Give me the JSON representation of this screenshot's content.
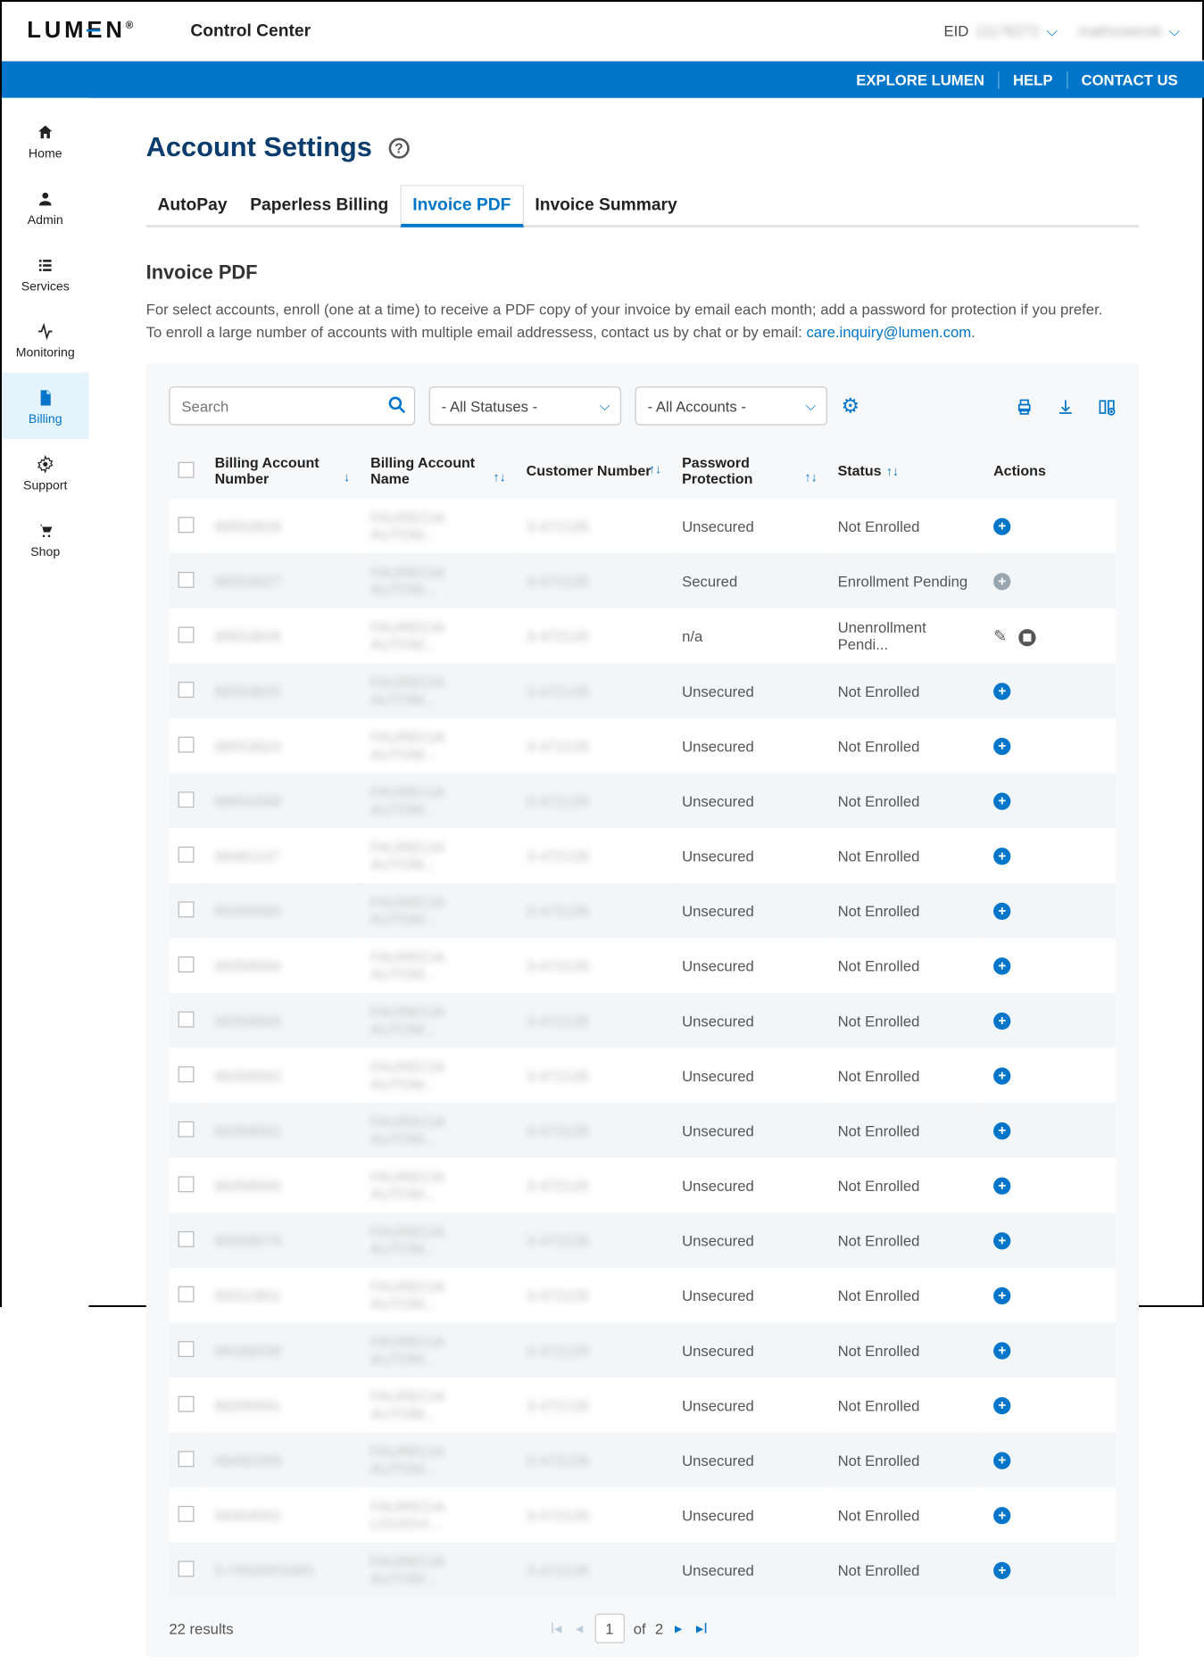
{
  "header": {
    "logo": "LUMEN",
    "logo_trademark": "®",
    "subtitle": "Control Center",
    "eid_label": "EID",
    "eid_value": "11176272",
    "user_value": "mathusiensk"
  },
  "bluebar": {
    "explore": "EXPLORE LUMEN",
    "help": "HELP",
    "contact": "CONTACT US"
  },
  "sidebar": {
    "items": [
      {
        "label": "Home",
        "icon": "home"
      },
      {
        "label": "Admin",
        "icon": "user"
      },
      {
        "label": "Services",
        "icon": "list"
      },
      {
        "label": "Monitoring",
        "icon": "pulse"
      },
      {
        "label": "Billing",
        "icon": "doc",
        "active": true
      },
      {
        "label": "Support",
        "icon": "gear"
      },
      {
        "label": "Shop",
        "icon": "cart"
      }
    ]
  },
  "page": {
    "title": "Account Settings",
    "tabs": [
      {
        "label": "AutoPay"
      },
      {
        "label": "Paperless Billing"
      },
      {
        "label": "Invoice PDF",
        "active": true
      },
      {
        "label": "Invoice Summary"
      }
    ],
    "section_title": "Invoice PDF",
    "desc_1": "For select accounts, enroll (one at a time) to receive a PDF copy of your invoice by email each month; add a password for protection if you prefer.",
    "desc_2_prefix": "To enroll a large number of accounts with multiple email addressess, contact us by chat or by email: ",
    "desc_2_link": "care.inquiry@lumen.com",
    "desc_2_suffix": "."
  },
  "filters": {
    "search_placeholder": "Search",
    "status_selected": "- All Statuses -",
    "accounts_selected": "- All Accounts -"
  },
  "columns": {
    "c1": "Billing Account Number",
    "c2": "Billing Account Name",
    "c3": "Customer Number",
    "c4": "Password Protection",
    "c5": "Status",
    "c6": "Actions"
  },
  "rows": [
    {
      "ban": "89553828",
      "name": "FAURECIA AUTOM...",
      "cust": "3-472135",
      "pp": "Unsecured",
      "status": "Not Enrolled",
      "action": "add"
    },
    {
      "ban": "89553827",
      "name": "FAURECIA AUTOM...",
      "cust": "3-472135",
      "pp": "Secured",
      "status": "Enrollment Pending",
      "action": "add-grey"
    },
    {
      "ban": "89553826",
      "name": "FAURECIA AUTOM...",
      "cust": "3-472135",
      "pp": "n/a",
      "status": "Unenrollment Pendi...",
      "action": "edit-stop"
    },
    {
      "ban": "89553825",
      "name": "FAURECIA AUTOM...",
      "cust": "3-472135",
      "pp": "Unsecured",
      "status": "Not Enrolled",
      "action": "add"
    },
    {
      "ban": "89553824",
      "name": "FAURECIA AUTOM...",
      "cust": "3-472135",
      "pp": "Unsecured",
      "status": "Not Enrolled",
      "action": "add"
    },
    {
      "ban": "89553358",
      "name": "FAURECIA AUTOM...",
      "cust": "3-472135",
      "pp": "Unsecured",
      "status": "Not Enrolled",
      "action": "add"
    },
    {
      "ban": "89481147",
      "name": "FAURECIA AUTOM...",
      "cust": "3-472135",
      "pp": "Unsecured",
      "status": "Not Enrolled",
      "action": "add"
    },
    {
      "ban": "89358585",
      "name": "FAURECIA AUTOM...",
      "cust": "3-472135",
      "pp": "Unsecured",
      "status": "Not Enrolled",
      "action": "add"
    },
    {
      "ban": "89358584",
      "name": "FAURECIA AUTOM...",
      "cust": "3-472135",
      "pp": "Unsecured",
      "status": "Not Enrolled",
      "action": "add"
    },
    {
      "ban": "89358583",
      "name": "FAURECIA AUTOM...",
      "cust": "3-472135",
      "pp": "Unsecured",
      "status": "Not Enrolled",
      "action": "add"
    },
    {
      "ban": "89358582",
      "name": "FAURECIA AUTOM...",
      "cust": "3-472135",
      "pp": "Unsecured",
      "status": "Not Enrolled",
      "action": "add"
    },
    {
      "ban": "89358581",
      "name": "FAURECIA AUTOM...",
      "cust": "3-472135",
      "pp": "Unsecured",
      "status": "Not Enrolled",
      "action": "add"
    },
    {
      "ban": "89358580",
      "name": "FAURECIA AUTOM...",
      "cust": "3-472135",
      "pp": "Unsecured",
      "status": "Not Enrolled",
      "action": "add"
    },
    {
      "ban": "89358579",
      "name": "FAURECIA AUTOM...",
      "cust": "3-472135",
      "pp": "Unsecured",
      "status": "Not Enrolled",
      "action": "add"
    },
    {
      "ban": "89312801",
      "name": "FAURECIA AUTOM...",
      "cust": "3-472135",
      "pp": "Unsecured",
      "status": "Not Enrolled",
      "action": "add"
    },
    {
      "ban": "89168338",
      "name": "FAURECIA AUTOM...",
      "cust": "3-472135",
      "pp": "Unsecured",
      "status": "Not Enrolled",
      "action": "add"
    },
    {
      "ban": "88395691",
      "name": "FAURECIA AUTOM...",
      "cust": "3-472135",
      "pp": "Unsecured",
      "status": "Not Enrolled",
      "action": "add"
    },
    {
      "ban": "68482369",
      "name": "FAURECIA AUTOM...",
      "cust": "3-472135",
      "pp": "Unsecured",
      "status": "Not Enrolled",
      "action": "add"
    },
    {
      "ban": "58304502",
      "name": "FAURECIA LOUISVI...",
      "cust": "3-472135",
      "pp": "Unsecured",
      "status": "Not Enrolled",
      "action": "add"
    },
    {
      "ban": "5-YRDNPGMS",
      "name": "FAURECIA AUTOM...",
      "cust": "3-472135",
      "pp": "Unsecured",
      "status": "Not Enrolled",
      "action": "add"
    }
  ],
  "pager": {
    "results": "22 results",
    "current": "1",
    "of_label": "of",
    "total": "2"
  }
}
